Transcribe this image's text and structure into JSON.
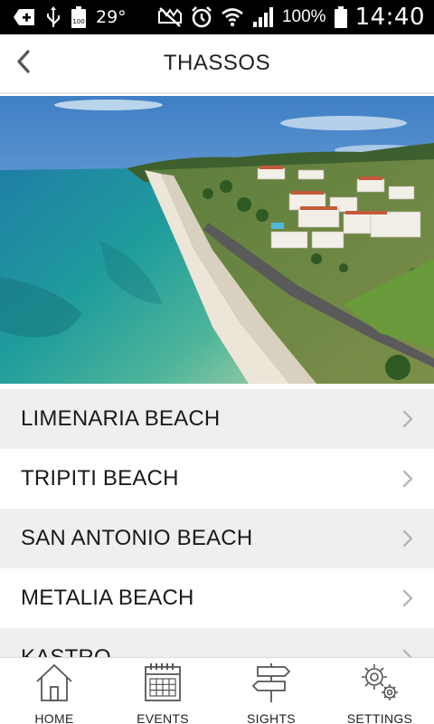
{
  "status_bar": {
    "temperature": "29°",
    "battery_percent": "100%",
    "battery_badge": "100",
    "time": "14:40",
    "icons": [
      "add-notification-icon",
      "usb-icon",
      "battery-small-icon",
      "mute-vibrate-icon",
      "alarm-icon",
      "wifi-icon",
      "signal-icon",
      "battery-icon"
    ]
  },
  "header": {
    "title": "THASSOS",
    "back_icon": "chevron-left-icon"
  },
  "hero": {
    "description_icon": "beach-photo"
  },
  "list": {
    "items": [
      {
        "label": "LIMENARIA BEACH"
      },
      {
        "label": "TRIPITI BEACH"
      },
      {
        "label": "SAN ANTONIO BEACH"
      },
      {
        "label": "METALIA BEACH"
      },
      {
        "label": "KASTRO"
      }
    ]
  },
  "bottom_nav": {
    "items": [
      {
        "label": "HOME",
        "icon": "house-icon"
      },
      {
        "label": "EVENTS",
        "icon": "calendar-icon"
      },
      {
        "label": "SIGHTS",
        "icon": "signpost-icon"
      },
      {
        "label": "SETTINGS",
        "icon": "gears-icon"
      }
    ]
  },
  "colors": {
    "status_bar_bg": "#000000",
    "list_alt_bg": "#efefef",
    "chevron": "#b5b5b5",
    "sea": "#2aa6a6"
  }
}
